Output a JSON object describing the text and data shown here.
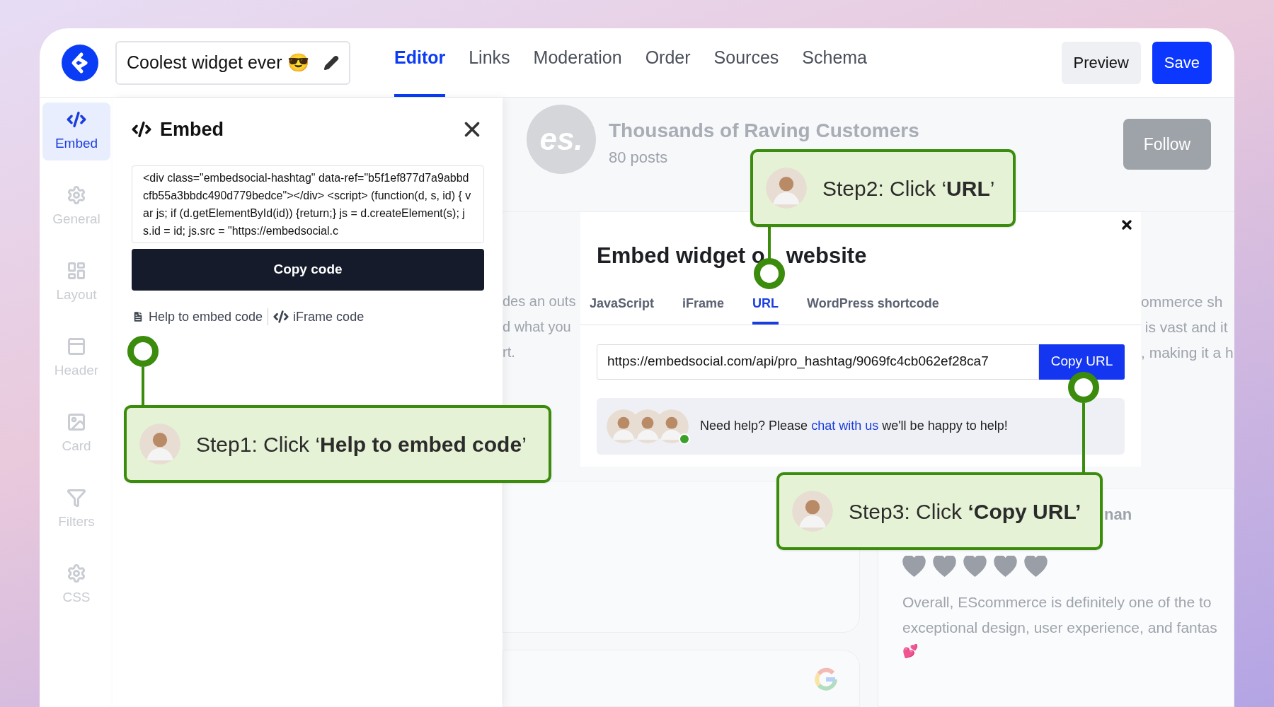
{
  "topbar": {
    "widget_title": "Coolest widget ever 😎",
    "nav": [
      {
        "label": "Editor",
        "selected": true
      },
      {
        "label": "Links",
        "selected": false
      },
      {
        "label": "Moderation",
        "selected": false
      },
      {
        "label": "Order",
        "selected": false
      },
      {
        "label": "Sources",
        "selected": false
      },
      {
        "label": "Schema",
        "selected": false
      }
    ],
    "preview_button": "Preview",
    "save_button": "Save"
  },
  "sidebar": {
    "items": [
      {
        "label": "Embed",
        "selected": true
      },
      {
        "label": "General",
        "selected": false
      },
      {
        "label": "Layout",
        "selected": false
      },
      {
        "label": "Header",
        "selected": false
      },
      {
        "label": "Card",
        "selected": false
      },
      {
        "label": "Filters",
        "selected": false
      },
      {
        "label": "CSS",
        "selected": false
      }
    ]
  },
  "embed_panel": {
    "title": "Embed",
    "code": "<div class=\"embedsocial-hashtag\" data-ref=\"b5f1ef877d7a9abbdcfb55a3bbdc490d779bedce\"></div> <script> (function(d, s, id) { var js; if (d.getElementById(id)) {return;} js = d.createElement(s); js.id = id; js.src = \"https://embedsocial.c",
    "copy_button": "Copy code",
    "links": [
      "Help to embed code",
      "iFrame code"
    ]
  },
  "preview": {
    "logo": "es.",
    "title": "Thousands of Raving Customers",
    "subtitle": "80 posts",
    "follow_button": "Follow",
    "left_fragments": [
      "des an outs",
      "d what you",
      "rt."
    ],
    "right_fragments": [
      "ommerce sh",
      " is vast and it",
      ", making it a h"
    ],
    "reviewer_fragment": "nan",
    "stars": 5,
    "review_lines": [
      "Overall, EScommerce is definitely one of the to",
      "exceptional design, user experience, and fantas"
    ],
    "emoji": "💕"
  },
  "modal": {
    "title_start": "Embed widget o",
    "title_end": "website",
    "tabs": [
      {
        "label": "JavaScript",
        "selected": false
      },
      {
        "label": "iFrame",
        "selected": false
      },
      {
        "label": "URL",
        "selected": true
      },
      {
        "label": "WordPress shortcode",
        "selected": false
      }
    ],
    "url": "https://embedsocial.com/api/pro_hashtag/9069fc4cb062ef28ca7",
    "copy_button": "Copy URL",
    "help_before": "Need help? Please ",
    "help_link": "chat with us",
    "help_after": " we'll be happy to help!"
  },
  "callouts": [
    {
      "text": "Step1: Click ‘**Help to embed code**’"
    },
    {
      "text": "Step2: Click ‘**URL**’"
    },
    {
      "text": "Step3: Click **‘Copy URL’**"
    }
  ]
}
